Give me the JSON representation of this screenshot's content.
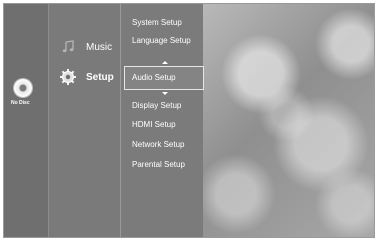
{
  "disc": {
    "label": "No Disc",
    "icon": "disc-icon"
  },
  "main_menu": {
    "items": [
      {
        "label": "Music",
        "icon": "music-note-icon",
        "selected": false
      },
      {
        "label": "Setup",
        "icon": "gear-icon",
        "selected": true
      }
    ]
  },
  "setup_menu": {
    "items": [
      {
        "label": "System Setup"
      },
      {
        "label": "Language Setup"
      },
      {
        "label": "Audio Setup",
        "selected": true
      },
      {
        "label": "Display Setup"
      },
      {
        "label": "HDMI Setup"
      },
      {
        "label": "Network Setup"
      },
      {
        "label": "Parental Setup"
      }
    ]
  },
  "colors": {
    "panel": "#7a7a7a",
    "text": "#ffffff",
    "highlight_border": "#e5e5e5"
  }
}
